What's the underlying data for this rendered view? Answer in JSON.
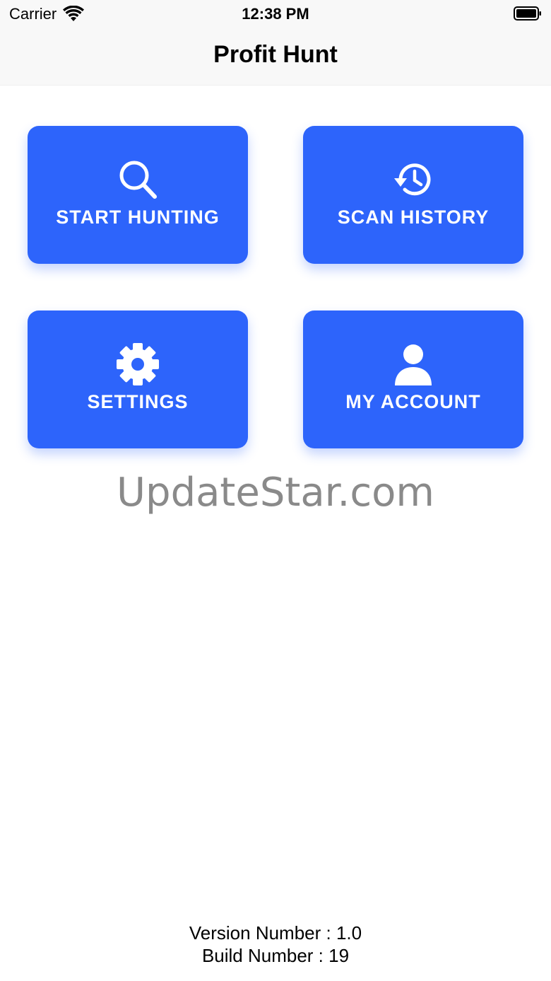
{
  "status_bar": {
    "carrier": "Carrier",
    "time": "12:38 PM",
    "wifi_icon": "wifi-icon",
    "battery_icon": "battery-icon"
  },
  "nav": {
    "title": "Profit Hunt"
  },
  "tiles": [
    {
      "label": "START HUNTING",
      "icon": "search-icon"
    },
    {
      "label": "SCAN HISTORY",
      "icon": "history-icon"
    },
    {
      "label": "SETTINGS",
      "icon": "gear-icon"
    },
    {
      "label": "MY ACCOUNT",
      "icon": "user-icon"
    }
  ],
  "watermark": "UpdateStar.com",
  "footer": {
    "version": "Version Number : 1.0",
    "build": "Build Number : 19"
  },
  "colors": {
    "tile_background": "#2d64fb",
    "tile_text": "#ffffff",
    "watermark": "#8a8a8a",
    "bar_background": "#f8f8f8"
  }
}
